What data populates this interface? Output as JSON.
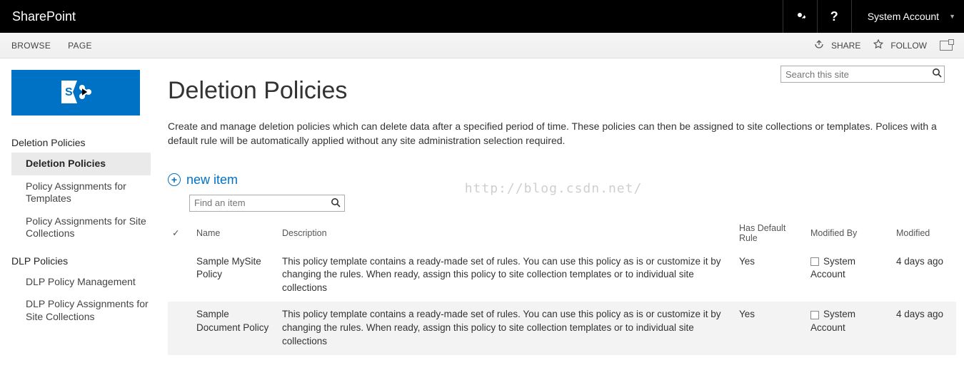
{
  "suite": {
    "title": "SharePoint",
    "user": "System Account"
  },
  "ribbon": {
    "tabs": [
      "BROWSE",
      "PAGE"
    ],
    "share": "SHARE",
    "follow": "FOLLOW"
  },
  "search": {
    "placeholder": "Search this site"
  },
  "nav": {
    "group1_header": "Deletion Policies",
    "group1_items": [
      "Deletion Policies",
      "Policy Assignments for Templates",
      "Policy Assignments for Site Collections"
    ],
    "group1_selected": 0,
    "group2_header": "DLP Policies",
    "group2_items": [
      "DLP Policy Management",
      "DLP Policy Assignments for Site Collections"
    ]
  },
  "page_title": "Deletion Policies",
  "page_desc": "Create and manage deletion policies which can delete data after a specified period of time. These policies can then be assigned to site collections or templates. Polices with a default rule will be automatically applied without any site administration selection required.",
  "watermark": "http://blog.csdn.net/",
  "new_item_label": "new item",
  "find": {
    "placeholder": "Find an item"
  },
  "columns": {
    "name": "Name",
    "desc": "Description",
    "def": "Has Default Rule",
    "modby": "Modified By",
    "mod": "Modified"
  },
  "rows": [
    {
      "name": "Sample MySite Policy",
      "desc": "This policy template contains a ready-made set of rules. You can use this policy as is or customize it by changing the rules. When ready, assign this policy to site collection templates or to individual site collections",
      "def": "Yes",
      "modby": "System Account",
      "mod": "4 days ago"
    },
    {
      "name": "Sample Document Policy",
      "desc": "This policy template contains a ready-made set of rules. You can use this policy as is or customize it by changing the rules. When ready, assign this policy to site collection templates or to individual site collections",
      "def": "Yes",
      "modby": "System Account",
      "mod": "4 days ago"
    }
  ]
}
